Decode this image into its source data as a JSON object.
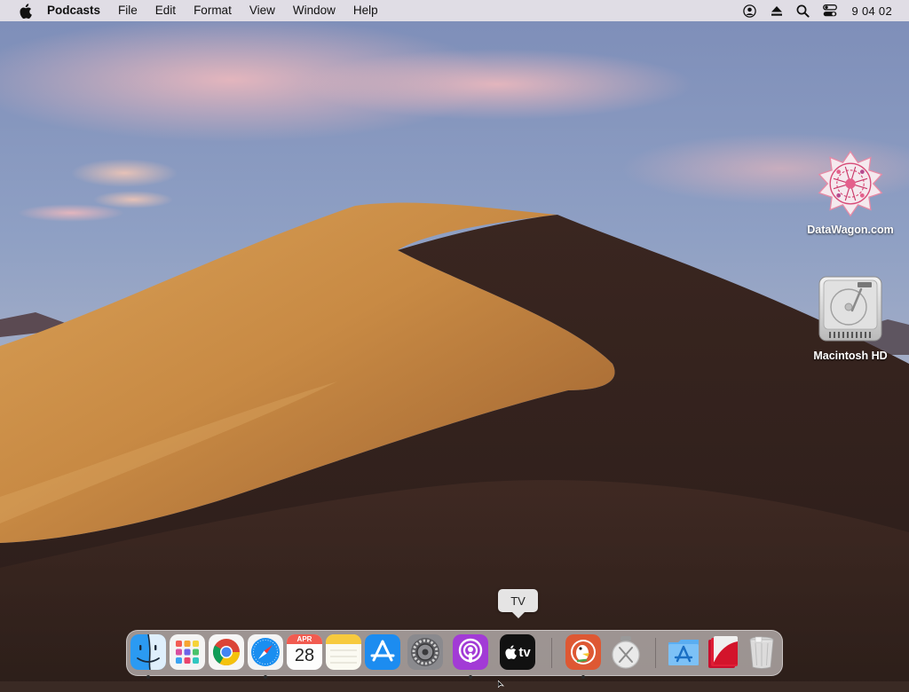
{
  "menubar": {
    "apple_icon": "apple-logo-icon",
    "app_name": "Podcasts",
    "items": [
      "File",
      "Edit",
      "Format",
      "View",
      "Window",
      "Help"
    ],
    "status_icons": [
      "user-account-icon",
      "eject-icon",
      "spotlight-search-icon",
      "control-center-icon"
    ],
    "clock": "9 04 02"
  },
  "desktop": {
    "wallpaper": "macOS Mojave desert dunes",
    "icons": [
      {
        "label": "DataWagon.com",
        "icon": "datawagon-logo-icon"
      },
      {
        "label": "Macintosh HD",
        "icon": "hard-drive-icon"
      }
    ]
  },
  "tooltip": {
    "text": "TV"
  },
  "dock": {
    "items": [
      {
        "name": "Finder",
        "icon": "finder-icon",
        "running": true
      },
      {
        "name": "Launchpad",
        "icon": "launchpad-icon",
        "running": false
      },
      {
        "name": "Google Chrome",
        "icon": "chrome-icon",
        "running": false
      },
      {
        "name": "Safari",
        "icon": "safari-icon",
        "running": true
      },
      {
        "name": "Calendar",
        "icon": "calendar-icon",
        "running": false,
        "month": "APR",
        "day": "28"
      },
      {
        "name": "Notes",
        "icon": "notes-icon",
        "running": false
      },
      {
        "name": "App Store",
        "icon": "app-store-icon",
        "running": false
      },
      {
        "name": "System Preferences",
        "icon": "system-preferences-icon",
        "running": false
      },
      {
        "name": "Podcasts",
        "icon": "podcasts-icon",
        "running": true
      },
      {
        "name": "TV",
        "icon": "apple-tv-icon",
        "running": false,
        "glyph_text": "tv"
      },
      {
        "name": "DuckDuckGo",
        "icon": "duckduckgo-icon",
        "running": true
      },
      {
        "name": "macOS Installer",
        "icon": "macos-installer-icon",
        "running": false
      },
      {
        "name": "Applications",
        "icon": "applications-folder-icon",
        "running": false
      },
      {
        "name": "Documents",
        "icon": "documents-stack-icon",
        "running": false
      },
      {
        "name": "Trash",
        "icon": "trash-icon",
        "running": false
      }
    ]
  },
  "colors": {
    "menubar_bg": "#e8e4e8",
    "dock_bg": "#e1dcdc",
    "podcasts_purple": "#a23bd6",
    "appstore_blue": "#1c8cf0",
    "duckduckgo_orange": "#de5833"
  }
}
